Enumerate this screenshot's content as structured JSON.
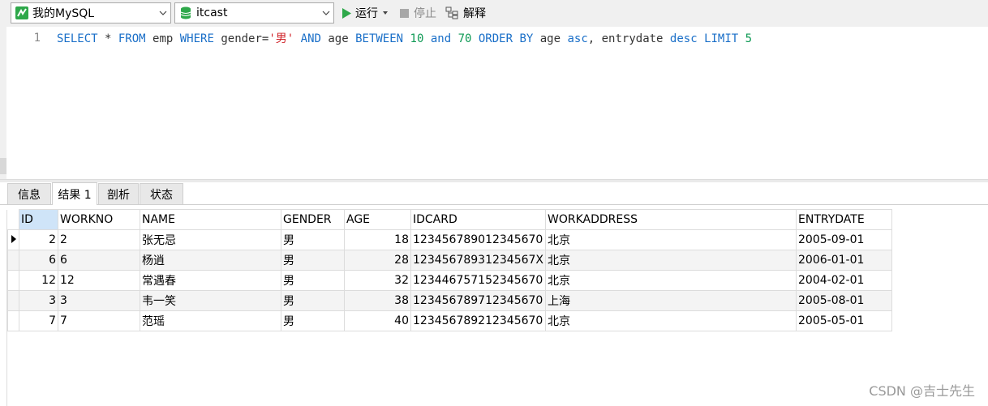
{
  "toolbar": {
    "connection_label": "我的MySQL",
    "database_label": "itcast",
    "run_label": "运行",
    "stop_label": "停止",
    "explain_label": "解释",
    "run_icon": "play-icon",
    "accent_green": "#2ea84a"
  },
  "editor": {
    "line_number": "1",
    "tokens": [
      {
        "t": "SELECT",
        "c": "kw"
      },
      {
        "t": " * ",
        "c": "txt"
      },
      {
        "t": "FROM",
        "c": "kw"
      },
      {
        "t": " emp ",
        "c": "txt"
      },
      {
        "t": "WHERE",
        "c": "kw"
      },
      {
        "t": " gender=",
        "c": "txt"
      },
      {
        "t": "'男'",
        "c": "str"
      },
      {
        "t": " ",
        "c": "txt"
      },
      {
        "t": "AND",
        "c": "kw"
      },
      {
        "t": " age ",
        "c": "txt"
      },
      {
        "t": "BETWEEN",
        "c": "kw"
      },
      {
        "t": " ",
        "c": "txt"
      },
      {
        "t": "10",
        "c": "num"
      },
      {
        "t": " ",
        "c": "txt"
      },
      {
        "t": "and",
        "c": "kw"
      },
      {
        "t": " ",
        "c": "txt"
      },
      {
        "t": "70",
        "c": "num"
      },
      {
        "t": " ",
        "c": "txt"
      },
      {
        "t": "ORDER BY",
        "c": "kw"
      },
      {
        "t": " age ",
        "c": "txt"
      },
      {
        "t": "asc",
        "c": "kw"
      },
      {
        "t": ", entrydate ",
        "c": "txt"
      },
      {
        "t": "desc",
        "c": "kw"
      },
      {
        "t": " ",
        "c": "txt"
      },
      {
        "t": "LIMIT",
        "c": "kw"
      },
      {
        "t": " ",
        "c": "txt"
      },
      {
        "t": "5",
        "c": "num"
      }
    ]
  },
  "tabs": [
    {
      "label": "信息"
    },
    {
      "label": "结果 1"
    },
    {
      "label": "剖析"
    },
    {
      "label": "状态"
    }
  ],
  "grid": {
    "columns": [
      "ID",
      "WORKNO",
      "NAME",
      "GENDER",
      "AGE",
      "IDCARD",
      "WORKADDRESS",
      "ENTRYDATE"
    ],
    "rows": [
      [
        "2",
        "2",
        "张无忌",
        "男",
        "18",
        "123456789012345670",
        "北京",
        "2005-09-01"
      ],
      [
        "6",
        "6",
        "杨逍",
        "男",
        "28",
        "12345678931234567X",
        "北京",
        "2006-01-01"
      ],
      [
        "12",
        "12",
        "常遇春",
        "男",
        "32",
        "123446757152345670",
        "北京",
        "2004-02-01"
      ],
      [
        "3",
        "3",
        "韦一笑",
        "男",
        "38",
        "123456789712345670",
        "上海",
        "2005-08-01"
      ],
      [
        "7",
        "7",
        "范瑶",
        "男",
        "40",
        "123456789212345670",
        "北京",
        "2005-05-01"
      ]
    ]
  },
  "watermark": "CSDN @吉士先生"
}
